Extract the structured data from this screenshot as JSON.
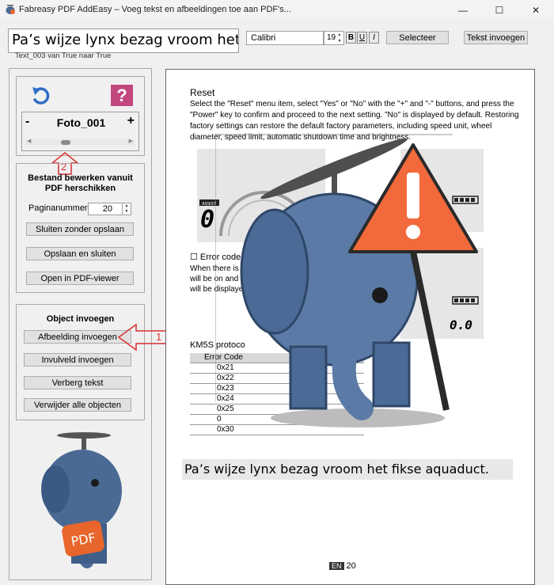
{
  "window": {
    "title": "Fabreasy PDF AddEasy – Voeg tekst en afbeeldingen toe aan PDF's...",
    "minimize_glyph": "—",
    "maximize_glyph": "☐",
    "close_glyph": "✕"
  },
  "toolbar": {
    "text_input_value": "Pa’s wijze lynx bezag vroom het fik",
    "status_text": "Text_003 van True naar True",
    "font_name": "Calibri",
    "font_size": "19",
    "bold_label": "B",
    "underline_label": "U",
    "italic_label": "I",
    "select_label": "Selecteer",
    "insert_text_label": "Tekst invoegen"
  },
  "navigator": {
    "help_glyph": "?",
    "photo_label": "Foto_001",
    "minus_label": "-",
    "plus_label": "+",
    "slider_left": "◀",
    "slider_right": "▶",
    "slider_position": 0.36
  },
  "edit_group": {
    "title": "Bestand bewerken vanuit PDF herschikken",
    "page_number_label": "Paginanummer",
    "page_number_value": "20",
    "close_no_save_label": "Sluiten zonder opslaan",
    "save_close_label": "Opslaan en sluiten",
    "open_viewer_label": "Open in PDF-viewer"
  },
  "object_group": {
    "title": "Object invoegen",
    "insert_image_label": "Afbeelding invoegen",
    "insert_field_label": "Invulveld invoegen",
    "hide_text_label": "Verberg tekst",
    "remove_all_label": "Verwijder alle objecten"
  },
  "callouts": {
    "one": "1",
    "two": "2",
    "color": "#d83030"
  },
  "logo": {
    "text": "PDF"
  },
  "document": {
    "heading": "Reset",
    "paragraph": "Select the \"Reset\" menu item, select \"Yes\" or \"No\" with the \"+\" and \"-\" buttons, and press the \"Power\" key to confirm and proceed to the next setting. \"No\" is displayed by default. Restoring factory settings can restore the default factory parameters, including speed unit, wheel diameter, speed limit, automatic shutdown time and brightness.",
    "error_heading": "☐ Error code",
    "error_lines": [
      "When there is a",
      "will be on and",
      "will be displaye"
    ],
    "display_digit": "0",
    "display_value": "0.0",
    "assist_label": "ASSIST",
    "km_title": "KM5S protoco",
    "table_header": "Error Code",
    "table_rows": [
      "0x21",
      "0x22",
      "0x23",
      "0x24",
      "0x25",
      "0",
      "0x30"
    ],
    "inserted_text": "Pa’s wijze lynx bezag vroom het fikse aquaduct.",
    "footer_badge": "EN",
    "footer_page": "20"
  }
}
